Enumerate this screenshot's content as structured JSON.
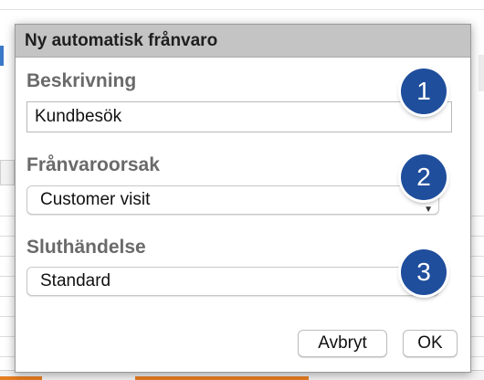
{
  "dialog": {
    "title": "Ny automatisk frånvaro",
    "fields": [
      {
        "label": "Beskrivning",
        "value": "Kundbesök",
        "badge": "1"
      },
      {
        "label": "Frånvaroorsak",
        "value": "Customer visit",
        "badge": "2"
      },
      {
        "label": "Sluthändelse",
        "value": "Standard",
        "badge": "3"
      }
    ],
    "buttons": {
      "cancel": "Avbryt",
      "ok": "OK"
    }
  },
  "colors": {
    "badge": "#1f4e9c",
    "titlebar": "#c4c4c4",
    "label": "#6a6a6a"
  }
}
